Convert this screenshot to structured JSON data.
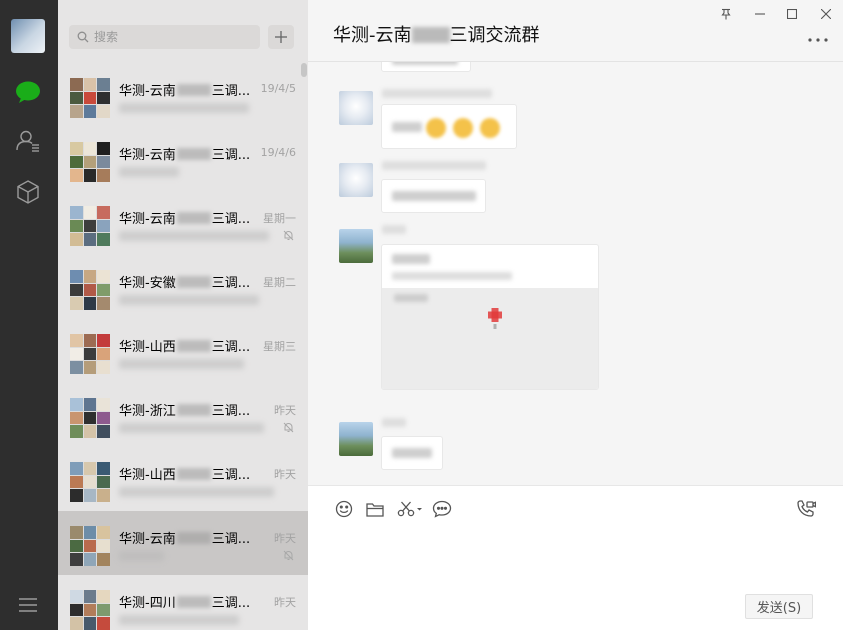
{
  "search": {
    "placeholder": "搜索"
  },
  "chat": {
    "title_prefix": "华测-云南",
    "title_suffix": "三调交流群"
  },
  "chats": [
    {
      "name_prefix": "华测-云南",
      "name_suffix": "三调...",
      "time": "19/4/5",
      "muted": false,
      "active": false
    },
    {
      "name_prefix": "华测-云南",
      "name_suffix": "三调...",
      "time": "19/4/6",
      "muted": false,
      "active": false
    },
    {
      "name_prefix": "华测-云南",
      "name_suffix": "三调...",
      "time": "星期一",
      "muted": true,
      "active": false
    },
    {
      "name_prefix": "华测-安徽",
      "name_suffix": "三调...",
      "time": "星期二",
      "muted": false,
      "active": false
    },
    {
      "name_prefix": "华测-山西",
      "name_suffix": "三调...",
      "time": "星期三",
      "muted": false,
      "active": false
    },
    {
      "name_prefix": "华测-浙江",
      "name_suffix": "三调...",
      "time": "昨天",
      "muted": true,
      "active": false
    },
    {
      "name_prefix": "华测-山西",
      "name_suffix": "三调...",
      "time": "昨天",
      "muted": false,
      "active": false
    },
    {
      "name_prefix": "华测-云南",
      "name_suffix": "三调...",
      "time": "昨天",
      "muted": true,
      "active": true
    },
    {
      "name_prefix": "华测-四川",
      "name_suffix": "三调...",
      "time": "昨天",
      "muted": false,
      "active": false
    }
  ],
  "input": {
    "send_label": "发送(S)"
  },
  "icons": {
    "rail": [
      "chat-icon",
      "contacts-icon",
      "favorites-icon",
      "menu-icon"
    ],
    "toolbar": [
      "emoji-icon",
      "folder-icon",
      "scissors-icon",
      "chat-history-icon",
      "video-call-icon"
    ],
    "window": [
      "pin-icon",
      "minimize-icon",
      "maximize-icon",
      "close-icon",
      "more-icon"
    ]
  },
  "colors": {
    "rail_bg": "#2e2e2e",
    "list_bg": "#e6e5e5",
    "active_item": "#c9c7c6",
    "chat_bg": "#f5f5f5",
    "accent_green": "#1aad19",
    "pin_red": "#e23b3b"
  }
}
